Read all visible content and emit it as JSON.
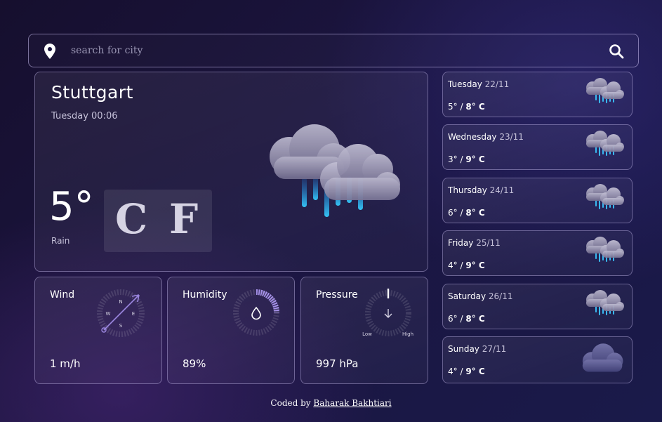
{
  "search": {
    "placeholder": "search for city",
    "icon": "search-icon",
    "location_icon": "map-pin-icon"
  },
  "current": {
    "city": "Stuttgart",
    "datetime": "Tuesday 00:06",
    "temperature": "5°",
    "condition": "Rain",
    "unit_c": "C",
    "unit_f": "F",
    "icon": "rain-cloud-icon"
  },
  "metrics": {
    "wind": {
      "title": "Wind",
      "value": "1 m/h",
      "compass": {
        "n": "N",
        "s": "S",
        "e": "E",
        "w": "W"
      }
    },
    "humidity": {
      "title": "Humidity",
      "value": "89%",
      "level": 0.89
    },
    "pressure": {
      "title": "Pressure",
      "value": "997 hPa",
      "low": "Low",
      "high": "High"
    }
  },
  "forecast": [
    {
      "day": "Tuesday",
      "date": "22/11",
      "low": "5°",
      "high": "8° C",
      "icon": "rain-cloud-icon"
    },
    {
      "day": "Wednesday",
      "date": "23/11",
      "low": "3°",
      "high": "9° C",
      "icon": "rain-cloud-icon"
    },
    {
      "day": "Thursday",
      "date": "24/11",
      "low": "6°",
      "high": "8° C",
      "icon": "rain-cloud-icon"
    },
    {
      "day": "Friday",
      "date": "25/11",
      "low": "4°",
      "high": "9° C",
      "icon": "rain-cloud-icon"
    },
    {
      "day": "Saturday",
      "date": "26/11",
      "low": "6°",
      "high": "8° C",
      "icon": "rain-cloud-icon"
    },
    {
      "day": "Sunday",
      "date": "27/11",
      "low": "4°",
      "high": "9° C",
      "icon": "cloud-icon"
    }
  ],
  "footer": {
    "prefix": "Coded by",
    "author": "Baharak Bakhtiari"
  },
  "colors": {
    "accent": "#9b86e0",
    "rain": "#2fb4f0",
    "background": "#1b1540"
  }
}
